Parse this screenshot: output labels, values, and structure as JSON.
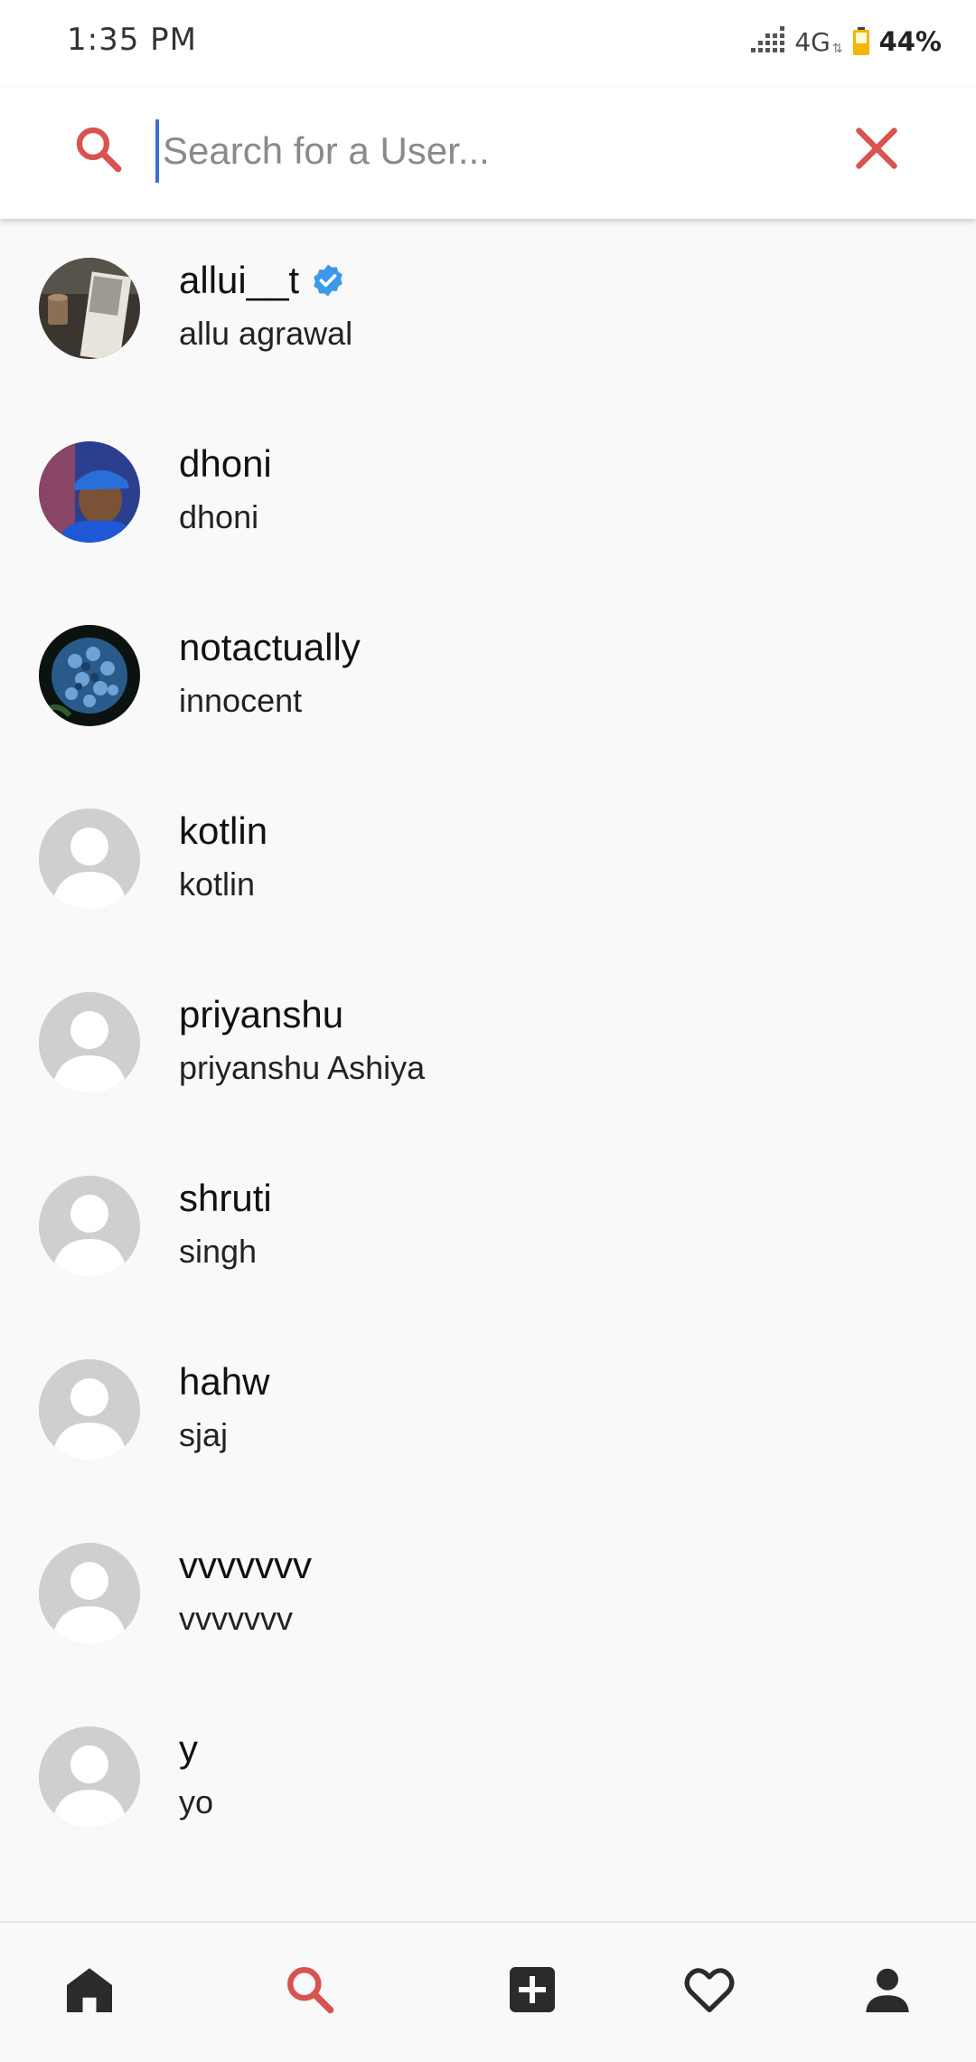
{
  "status_bar": {
    "time": "1:35 PM",
    "network": "4G",
    "battery_percent": "44%",
    "battery_color": "#f5b400"
  },
  "search": {
    "placeholder": "Search for a User...",
    "value": "",
    "accent_color": "#d9534f"
  },
  "users": [
    {
      "username": "allui__t",
      "full_name": "allu agrawal",
      "verified": true,
      "avatar": "photo-notebook"
    },
    {
      "username": "dhoni",
      "full_name": "dhoni",
      "verified": false,
      "avatar": "photo-cricketer"
    },
    {
      "username": "notactually",
      "full_name": "innocent",
      "verified": false,
      "avatar": "photo-flowers"
    },
    {
      "username": "kotlin",
      "full_name": "kotlin",
      "verified": false,
      "avatar": "default-avatar"
    },
    {
      "username": "priyanshu",
      "full_name": "priyanshu Ashiya",
      "verified": false,
      "avatar": "default-avatar"
    },
    {
      "username": "shruti",
      "full_name": "singh",
      "verified": false,
      "avatar": "default-avatar"
    },
    {
      "username": "hahw",
      "full_name": "sjaj",
      "verified": false,
      "avatar": "default-avatar"
    },
    {
      "username": "vvvvvvv",
      "full_name": "vvvvvvv",
      "verified": false,
      "avatar": "default-avatar"
    },
    {
      "username": "y",
      "full_name": "yo",
      "verified": false,
      "avatar": "default-avatar"
    }
  ],
  "bottom_nav": [
    {
      "name": "home",
      "icon": "home-icon",
      "active": false
    },
    {
      "name": "search",
      "icon": "search-icon",
      "active": true
    },
    {
      "name": "add-post",
      "icon": "add-box-icon",
      "active": false
    },
    {
      "name": "activity",
      "icon": "heart-icon",
      "active": false
    },
    {
      "name": "profile",
      "icon": "person-icon",
      "active": false
    }
  ],
  "colors": {
    "accent": "#d9534f",
    "verified_badge": "#3d98e8",
    "icon_dark": "#2b2b2b"
  }
}
